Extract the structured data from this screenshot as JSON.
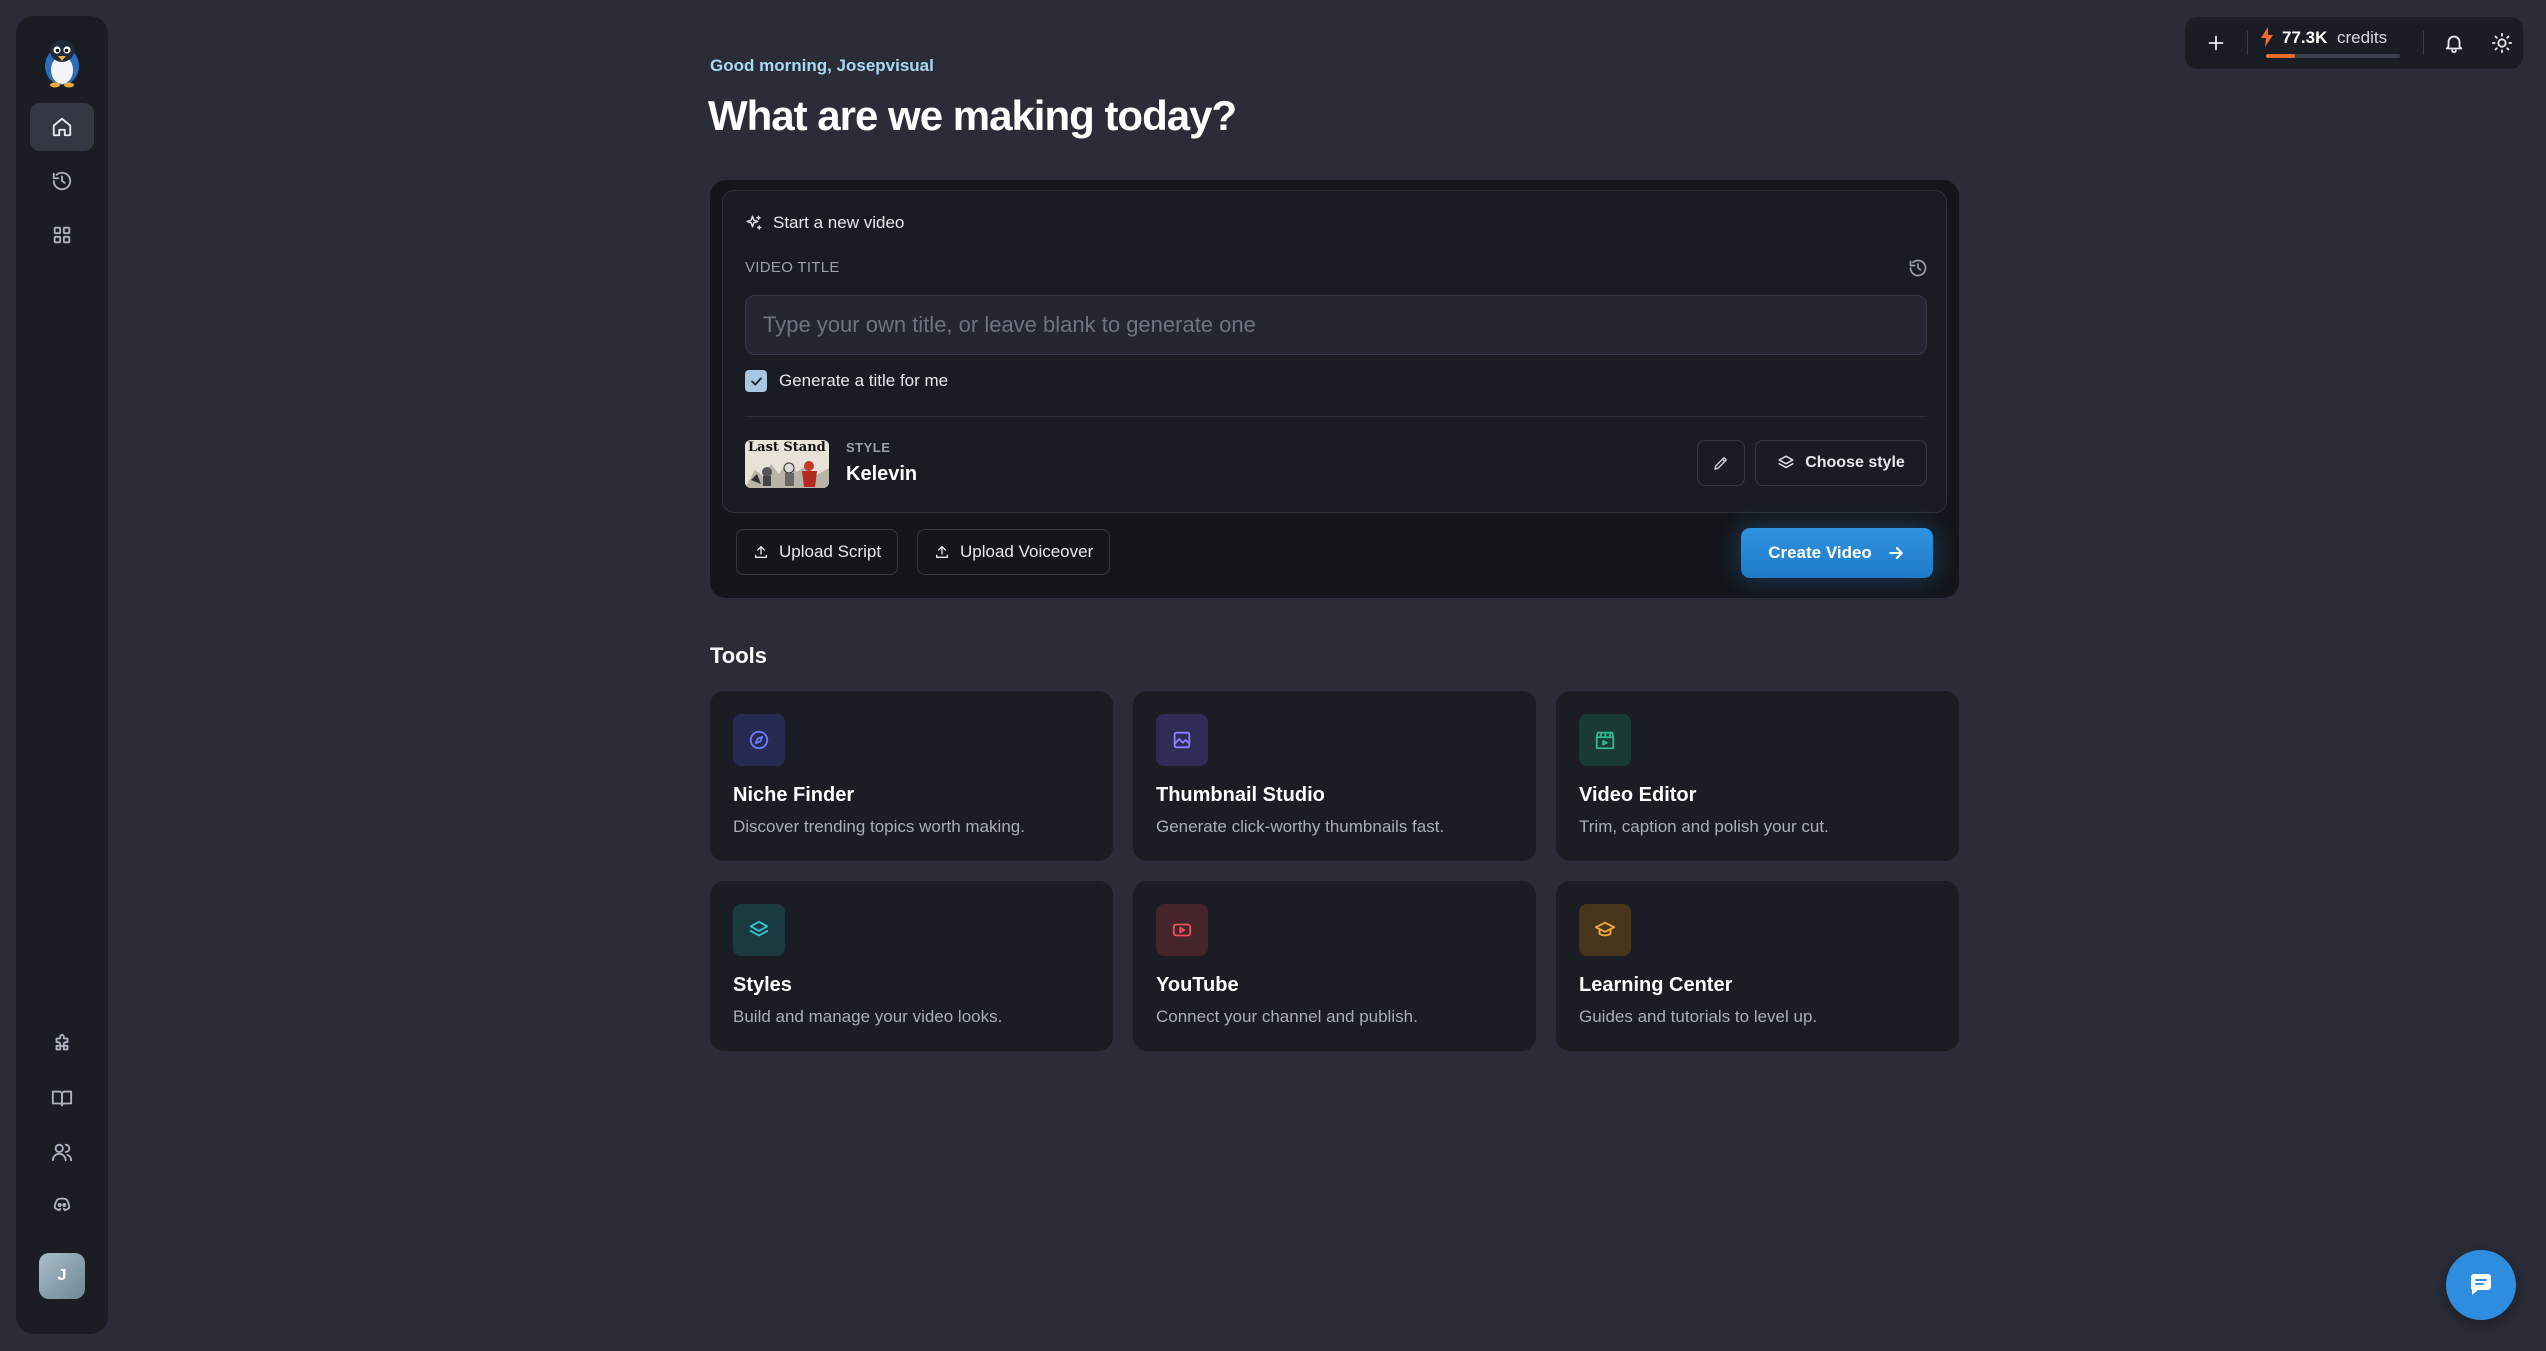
{
  "topbar": {
    "credits_value": "77.3K",
    "credits_label": "credits",
    "credits_progress": 0.22
  },
  "header": {
    "greeting": "Good morning, Josepvisual",
    "headline": "What are we making today?"
  },
  "composer": {
    "start_label": "Start a new video",
    "title_label": "VIDEO TITLE",
    "title_placeholder": "Type your own title, or leave blank to generate one",
    "title_value": "",
    "generate_title_label": "Generate a title for me",
    "generate_title_checked": true,
    "style_tag": "STYLE",
    "style_name": "Kelevin",
    "style_thumb_text": "Last Stand",
    "choose_style_label": "Choose style",
    "upload_script_label": "Upload Script",
    "upload_voiceover_label": "Upload Voiceover",
    "create_label": "Create Video"
  },
  "tools": {
    "title": "Tools",
    "items": [
      {
        "name": "Niche Finder",
        "desc": "Discover trending topics worth making.",
        "icon": "compass-icon",
        "color": "#6b7cff",
        "bg": "#262b52"
      },
      {
        "name": "Thumbnail Studio",
        "desc": "Generate click-worthy thumbnails fast.",
        "icon": "image-icon",
        "color": "#8c82ff",
        "bg": "#2e2b55"
      },
      {
        "name": "Video Editor",
        "desc": "Trim, caption and polish your cut.",
        "icon": "clapper-icon",
        "color": "#2fb98a",
        "bg": "#1b3a33"
      },
      {
        "name": "Styles",
        "desc": "Build and manage your video looks.",
        "icon": "layers-icon",
        "color": "#34c3d6",
        "bg": "#1a3a42"
      },
      {
        "name": "YouTube",
        "desc": "Connect your channel and publish.",
        "icon": "youtube-icon",
        "color": "#f0505a",
        "bg": "#45242a"
      },
      {
        "name": "Learning Center",
        "desc": "Guides and tutorials to level up.",
        "icon": "graduation-cap-icon",
        "color": "#f2a93b",
        "bg": "#47361c"
      }
    ]
  },
  "user": {
    "avatar_initial": "J"
  },
  "colors": {
    "accent": "#2f8de0",
    "credits_bar": "#f26b2d",
    "greeting": "#a9d8f2"
  }
}
